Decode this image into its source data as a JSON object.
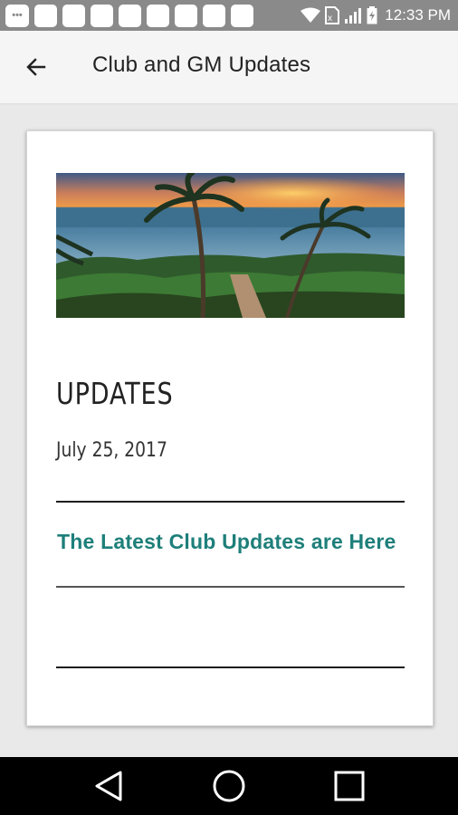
{
  "status_bar": {
    "time": "12:33 PM",
    "notification_count": 8,
    "icons": [
      "message-icon",
      "wifi-icon",
      "no-sim-icon",
      "signal-icon",
      "battery-icon"
    ]
  },
  "app_bar": {
    "title": "Club and GM Updates",
    "back_icon": "arrow-left-icon"
  },
  "card": {
    "hero_image": "sunset-beach-palm-trees",
    "heading": "UPDATES",
    "date": "July 25, 2017",
    "link_text": "The Latest Club Updates are Here",
    "link_color": "#1e7f7a"
  },
  "nav_bar": {
    "icons": [
      "back-triangle-icon",
      "home-circle-icon",
      "recent-apps-square-icon"
    ]
  }
}
